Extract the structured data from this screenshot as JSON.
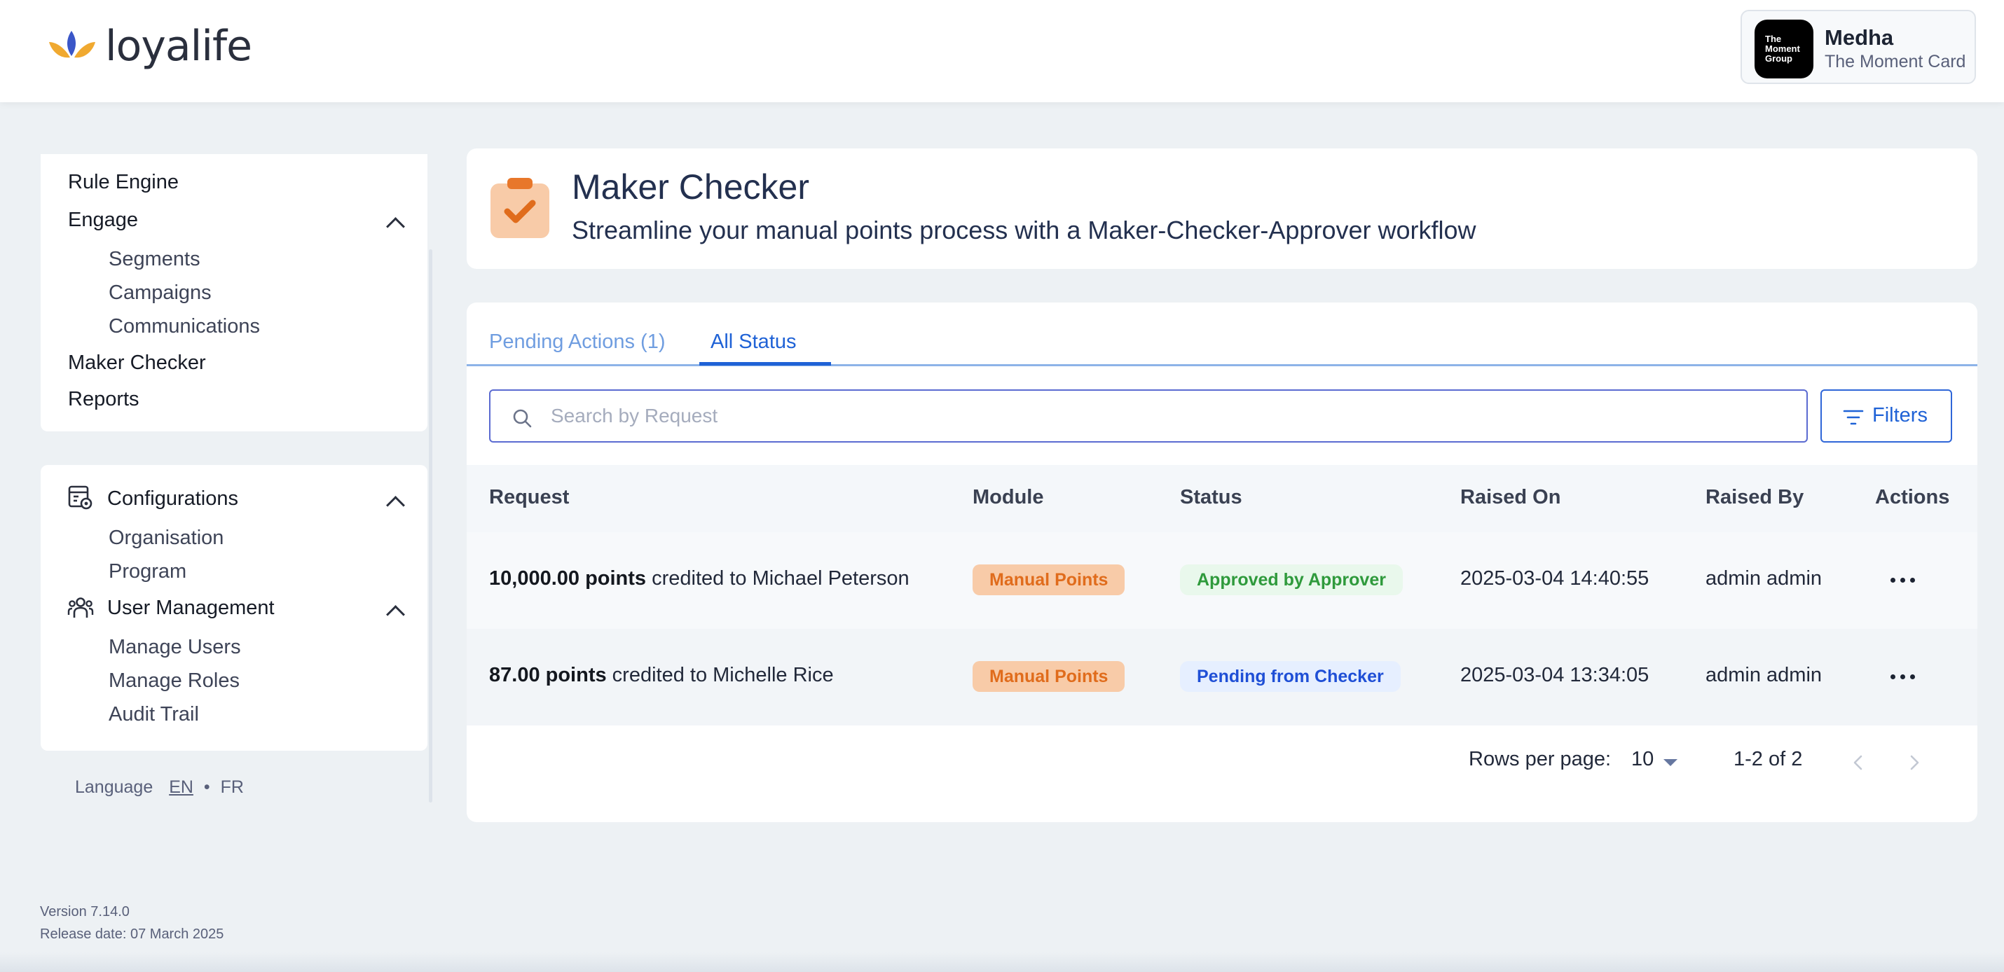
{
  "brand": {
    "name": "loyalife"
  },
  "user": {
    "name": "Medha",
    "org": "The Moment Card",
    "avatar_text": "The Moment Group"
  },
  "sidebar": {
    "section1": {
      "rule_engine": "Rule Engine",
      "engage": "Engage",
      "engage_items": [
        "Segments",
        "Campaigns",
        "Communications"
      ],
      "maker_checker": "Maker Checker",
      "reports": "Reports"
    },
    "section2": {
      "configurations": "Configurations",
      "configurations_items": [
        "Organisation",
        "Program"
      ],
      "user_management": "User Management",
      "user_management_items": [
        "Manage Users",
        "Manage Roles",
        "Audit Trail"
      ]
    },
    "language": {
      "label": "Language",
      "en": "EN",
      "separator": "•",
      "fr": "FR"
    }
  },
  "footer": {
    "version": "Version 7.14.0",
    "release": "Release date: 07 March 2025"
  },
  "page": {
    "title": "Maker Checker",
    "subtitle": "Streamline your manual points process with a Maker-Checker-Approver workflow"
  },
  "tabs": [
    {
      "label": "Pending Actions (1)",
      "active": false
    },
    {
      "label": "All Status",
      "active": true
    }
  ],
  "search": {
    "placeholder": "Search by Request"
  },
  "filters": {
    "label": "Filters"
  },
  "table": {
    "columns": [
      "Request",
      "Module",
      "Status",
      "Raised On",
      "Raised By",
      "Actions"
    ],
    "rows": [
      {
        "points": "10,000.00 points",
        "rest": " credited to Michael Peterson",
        "module": "Manual Points",
        "status": "Approved by Approver",
        "raised_on": "2025-03-04 14:40:55",
        "raised_by": "admin admin"
      },
      {
        "points": "87.00 points",
        "rest": " credited to Michelle Rice",
        "module": "Manual Points",
        "status": "Pending from Checker",
        "raised_on": "2025-03-04 13:34:05",
        "raised_by": "admin admin"
      }
    ]
  },
  "pagination": {
    "rows_label": "Rows per page:",
    "rows_value": "10",
    "range": "1-2 of 2"
  },
  "colors": {
    "accent": "#1f62d6",
    "module_badge_bg": "#f8cba8",
    "module_badge_text": "#e06c1c",
    "approved_bg": "#e9f8ec",
    "approved_text": "#2f9a3c",
    "pending_bg": "#e6efff",
    "pending_text": "#1f4fd6"
  },
  "icons": [
    "loyalife-logo",
    "configurations-icon",
    "user-management-icon",
    "chevron-up-icon",
    "maker-checker-clipboard-icon",
    "search-icon",
    "filter-icon",
    "more-horizontal-icon",
    "chevron-left-icon",
    "chevron-right-icon",
    "caret-down-icon"
  ]
}
